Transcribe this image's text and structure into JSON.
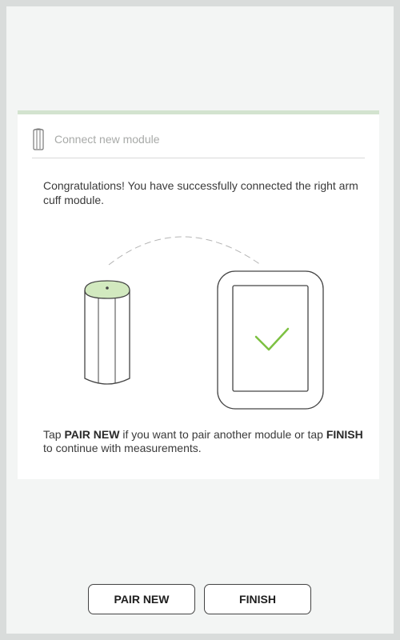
{
  "card": {
    "title": "Connect new module",
    "intro": "Congratulations! You have successfully connected the right arm cuff module.",
    "footer": {
      "part1": "Tap ",
      "pair_keyword": "PAIR NEW",
      "part2": " if you want to pair another module or tap ",
      "finish_keyword": "FINISH",
      "part3": " to continue with measurements."
    }
  },
  "buttons": {
    "pair_new": "PAIR NEW",
    "finish": "FINISH"
  },
  "icons": {
    "header": "module-icon",
    "module": "module-device",
    "tablet": "tablet-device",
    "check": "checkmark-icon"
  },
  "colors": {
    "accent": "#7dc142",
    "card_border": "#d3e3cf"
  }
}
